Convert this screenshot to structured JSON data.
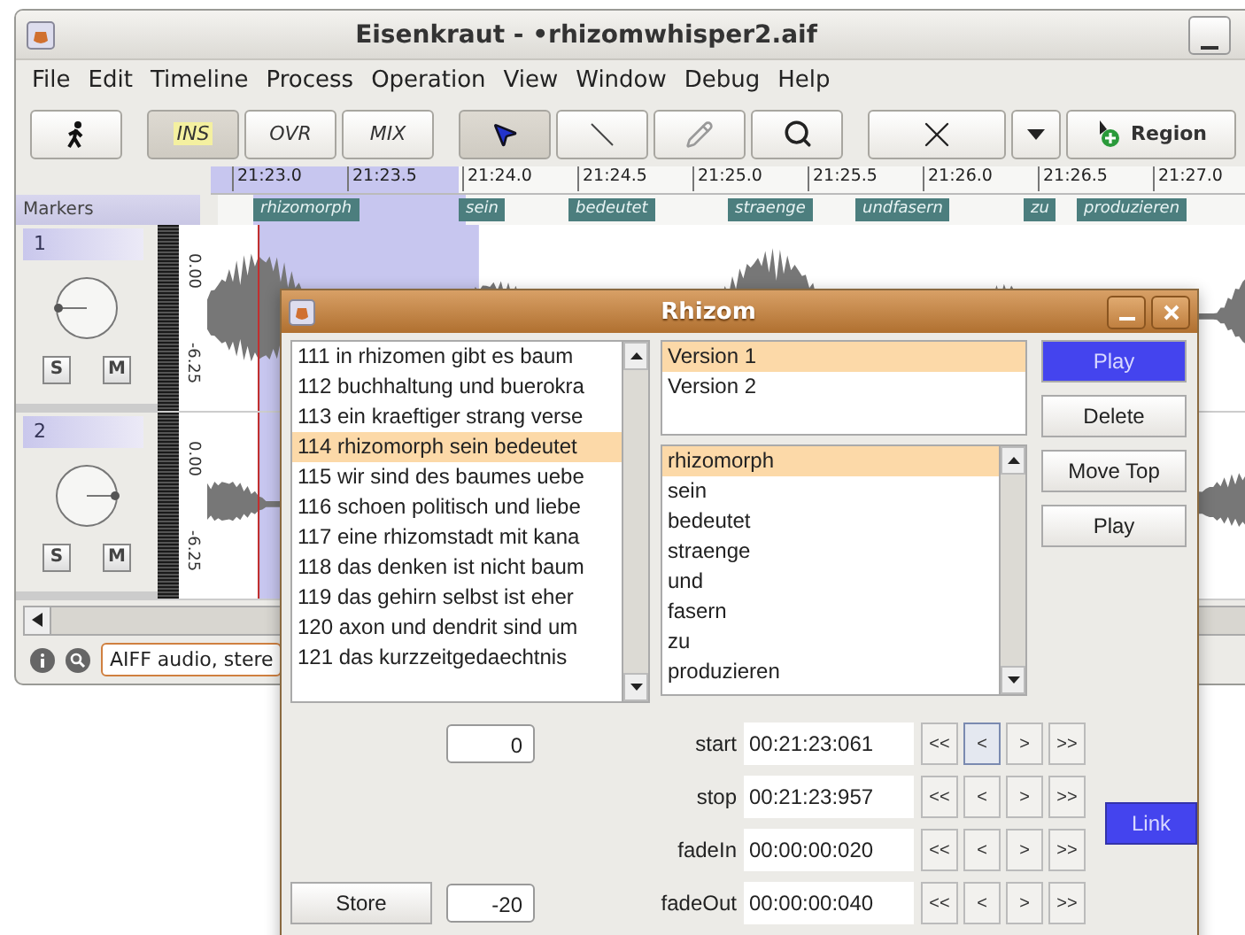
{
  "window": {
    "title": "Eisenkraut - •rhizomwhisper2.aif"
  },
  "menu": [
    "File",
    "Edit",
    "Timeline",
    "Process",
    "Operation",
    "View",
    "Window",
    "Debug",
    "Help"
  ],
  "toolbar": {
    "transport": [
      {
        "selected": false
      }
    ],
    "modes": [
      {
        "label": "INS",
        "selected": true
      },
      {
        "label": "OVR",
        "selected": false
      },
      {
        "label": "MIX",
        "selected": false
      }
    ],
    "tools": [
      {
        "selected": true
      },
      {
        "selected": false
      },
      {
        "selected": false
      },
      {
        "selected": false
      }
    ],
    "region_button": "Region"
  },
  "ruler": [
    "21:23.0",
    "21:23.5",
    "21:24.0",
    "21:24.5",
    "21:25.0",
    "21:25.5",
    "21:26.0",
    "21:26.5",
    "21:27.0"
  ],
  "markers": {
    "label": "Markers",
    "items": [
      "rhizomorph",
      "sein",
      "bedeutet",
      "straenge",
      "undfasern",
      "zu",
      "produzieren"
    ]
  },
  "tracks": [
    {
      "name": "1",
      "scale": [
        "0.00",
        "-6.25"
      ]
    },
    {
      "name": "2",
      "scale": [
        "0.00",
        "-6.25"
      ]
    }
  ],
  "track_buttons": [
    [
      "S",
      "M"
    ],
    [
      "S",
      "M"
    ]
  ],
  "status": {
    "text": "AIFF audio, stere"
  },
  "dialog": {
    "title": "Rhizom",
    "lines": [
      {
        "text": "111 in rhizomen gibt es baum",
        "selected": false
      },
      {
        "text": "112 buchhaltung und buerokra",
        "selected": false
      },
      {
        "text": "113 ein kraeftiger strang verse",
        "selected": false
      },
      {
        "text": "114 rhizomorph sein bedeutet",
        "selected": true
      },
      {
        "text": "115 wir sind des baumes uebe",
        "selected": false
      },
      {
        "text": "116 schoen politisch und liebe",
        "selected": false
      },
      {
        "text": "117 eine rhizomstadt mit kana",
        "selected": false
      },
      {
        "text": "118 das denken ist nicht baum",
        "selected": false
      },
      {
        "text": "119 das gehirn selbst ist eher",
        "selected": false
      },
      {
        "text": "120 axon und dendrit sind um",
        "selected": false
      },
      {
        "text": "121 das kurzzeitgedaechtnis",
        "selected": false
      }
    ],
    "versions": [
      {
        "text": "Version 1",
        "selected": true
      },
      {
        "text": "Version 2",
        "selected": false
      }
    ],
    "words": [
      {
        "text": "rhizomorph",
        "selected": true
      },
      {
        "text": "sein",
        "selected": false
      },
      {
        "text": "bedeutet",
        "selected": false
      },
      {
        "text": "straenge",
        "selected": false
      },
      {
        "text": "und",
        "selected": false
      },
      {
        "text": "fasern",
        "selected": false
      },
      {
        "text": "zu",
        "selected": false
      },
      {
        "text": "produzieren",
        "selected": false
      }
    ],
    "side_buttons": [
      {
        "label": "Play",
        "highlighted": true
      },
      {
        "label": "Delete",
        "highlighted": false
      },
      {
        "label": "Move Top",
        "highlighted": false
      },
      {
        "label": "Play",
        "highlighted": false
      }
    ],
    "offset_value": "0",
    "store_button": "Store",
    "store_value": "-20",
    "times": [
      {
        "label": "start",
        "value": "00:21:23:061",
        "buttons": [
          {
            "label": "<<",
            "focused": false
          },
          {
            "label": "<",
            "focused": true
          },
          {
            "label": ">",
            "focused": false
          },
          {
            "label": ">>",
            "focused": false
          }
        ]
      },
      {
        "label": "stop",
        "value": "00:21:23:957",
        "buttons": [
          {
            "label": "<<",
            "focused": false
          },
          {
            "label": "<",
            "focused": false
          },
          {
            "label": ">",
            "focused": false
          },
          {
            "label": ">>",
            "focused": false
          }
        ]
      },
      {
        "label": "fadeIn",
        "value": "00:00:00:020",
        "buttons": [
          {
            "label": "<<",
            "focused": false
          },
          {
            "label": "<",
            "focused": false
          },
          {
            "label": ">",
            "focused": false
          },
          {
            "label": ">>",
            "focused": false
          }
        ]
      },
      {
        "label": "fadeOut",
        "value": "00:00:00:040",
        "buttons": [
          {
            "label": "<<",
            "focused": false
          },
          {
            "label": "<",
            "focused": false
          },
          {
            "label": ">",
            "focused": false
          },
          {
            "label": ">>",
            "focused": false
          }
        ]
      }
    ],
    "link_button": "Link"
  }
}
